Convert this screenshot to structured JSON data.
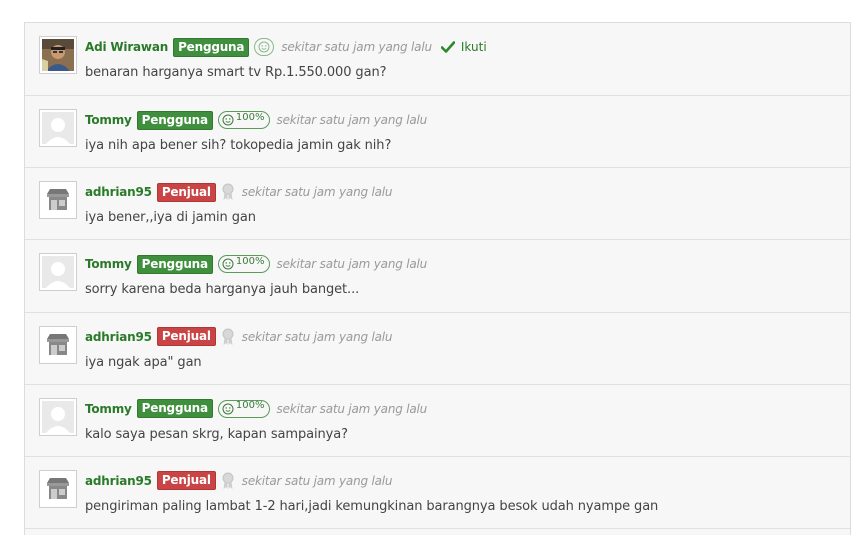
{
  "comments": [
    {
      "name": "Adi Wirawan",
      "role": "Pengguna",
      "role_type": "user",
      "avatar": "photo-avatar",
      "rep": "",
      "rep_icon": "smiley-icon",
      "time": "sekitar satu jam yang lalu",
      "follow": "Ikuti",
      "text": "benaran harganya smart tv Rp.1.550.000 gan?"
    },
    {
      "name": "Tommy",
      "role": "Pengguna",
      "role_type": "user",
      "avatar": "default-avatar",
      "rep": "100%",
      "rep_icon": "smiley-icon",
      "time": "sekitar satu jam yang lalu",
      "text": "iya nih apa bener sih? tokopedia jamin gak nih?"
    },
    {
      "name": "adhrian95",
      "role": "Penjual",
      "role_type": "seller",
      "avatar": "shop-avatar",
      "rep_icon": "medal-icon",
      "time": "sekitar satu jam yang lalu",
      "text": "iya bener,,iya di jamin gan"
    },
    {
      "name": "Tommy",
      "role": "Pengguna",
      "role_type": "user",
      "avatar": "default-avatar",
      "rep": "100%",
      "rep_icon": "smiley-icon",
      "time": "sekitar satu jam yang lalu",
      "text": "sorry karena beda harganya jauh banget..."
    },
    {
      "name": "adhrian95",
      "role": "Penjual",
      "role_type": "seller",
      "avatar": "shop-avatar",
      "rep_icon": "medal-icon",
      "time": "sekitar satu jam yang lalu",
      "text": "iya ngak apa\" gan"
    },
    {
      "name": "Tommy",
      "role": "Pengguna",
      "role_type": "user",
      "avatar": "default-avatar",
      "rep": "100%",
      "rep_icon": "smiley-icon",
      "time": "sekitar satu jam yang lalu",
      "text": "kalo saya pesan skrg, kapan sampainya?"
    },
    {
      "name": "adhrian95",
      "role": "Penjual",
      "role_type": "seller",
      "avatar": "shop-avatar",
      "rep_icon": "medal-icon",
      "time": "sekitar satu jam yang lalu",
      "text": "pengiriman paling lambat 1-2 hari,jadi kemungkinan barangnya besok udah nyampe gan"
    }
  ],
  "colors": {
    "name": "#2a7a2a",
    "user_badge": "#3f8f3f",
    "seller_badge": "#c94545",
    "time": "#9a9a9a"
  }
}
